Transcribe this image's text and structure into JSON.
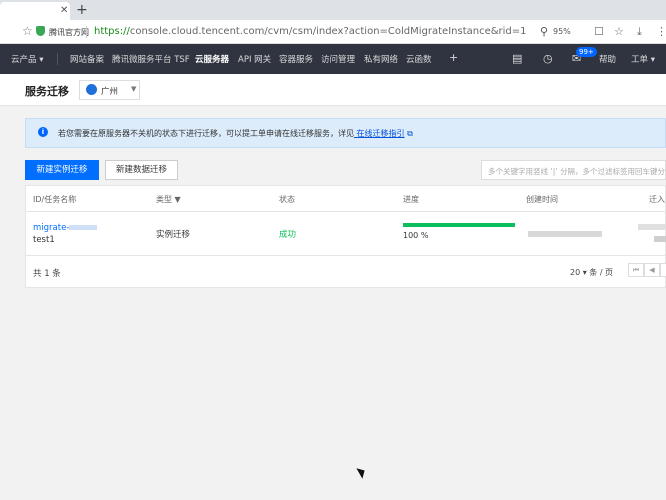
{
  "browser": {
    "tab_close": "✕",
    "new_tab": "+",
    "site_label": "腾讯官方网",
    "url_scheme": "https://",
    "url_rest": "console.cloud.tencent.com/cvm/csm/index?action=ColdMigrateInstance&rid=1",
    "zoom": "95%"
  },
  "topnav": {
    "items": [
      "云产品 ▾",
      "网站备案",
      "腾讯微服务平台 TSF",
      "云服务器",
      "API 网关",
      "容器服务",
      "访问管理",
      "私有网络",
      "云函数",
      "+"
    ],
    "active_index": 3,
    "badge": "99+",
    "help": "帮助",
    "tools": "工单 ▾"
  },
  "header": {
    "title": "服务迁移",
    "region": "广州"
  },
  "notice": {
    "text": "若您需要在原服务器不关机的状态下进行迁移，可以提工单申请在线迁移服务，详见",
    "link": " 在线迁移指引"
  },
  "toolbar": {
    "create_instance_migration": "新建实例迁移",
    "create_data_migration": "新建数据迁移",
    "search_placeholder": "多个关键字用竖线 ‘|’ 分隔，多个过滤标签用回车键分隔"
  },
  "table": {
    "columns": [
      "ID/任务名称",
      "类型 ▼",
      "状态",
      "进度",
      "创建时间",
      "迁入"
    ],
    "rows": [
      {
        "id": "migrate-",
        "name": "test1",
        "type": "实例迁移",
        "status": "成功",
        "progress": 100,
        "progress_text": "100 %"
      }
    ],
    "total": "共 1 条",
    "page_size": "20 ▾  条 / 页"
  },
  "colors": {
    "nav_bg": "#2f3440",
    "primary": "#006eff",
    "success": "#0abf5b",
    "notice_bg": "#dcecfb"
  }
}
